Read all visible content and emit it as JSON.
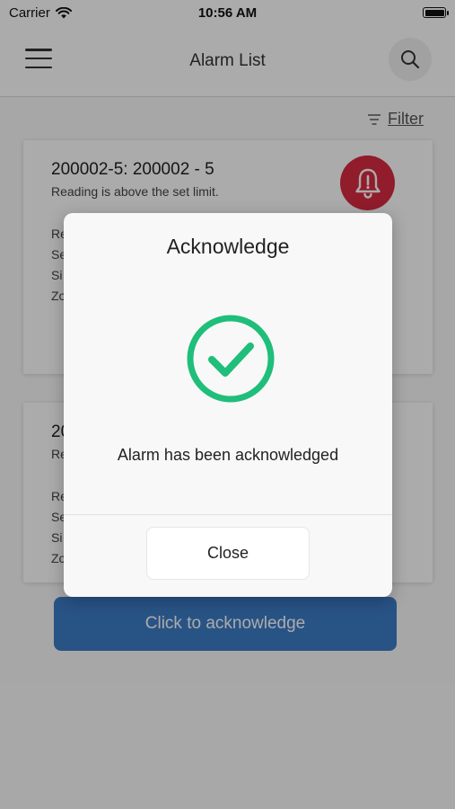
{
  "status_bar": {
    "carrier": "Carrier",
    "time": "10:56 AM"
  },
  "header": {
    "title": "Alarm List",
    "menu_icon": "hamburger-menu-icon",
    "search_icon": "search-icon"
  },
  "filter": {
    "label": "Filter",
    "icon": "filter-lines-icon"
  },
  "cards": [
    {
      "title": "200002-5: 200002 - 5",
      "subtitle": "Reading is above the set limit.",
      "details": [
        "Re",
        "Se",
        "Si",
        "Zo"
      ],
      "icon": "alarm-bell-alert-icon",
      "icon_color": "#d82b40"
    },
    {
      "title": "20",
      "subtitle": "Re",
      "details": [
        "Re",
        "Se",
        "Si",
        "Zo"
      ]
    }
  ],
  "acknowledge_button": {
    "label": "Click to acknowledge",
    "color": "#3d7dc6"
  },
  "dialog": {
    "title": "Acknowledge",
    "message": "Alarm has been acknowledged",
    "close_label": "Close",
    "icon": "check-circle-icon",
    "icon_color": "#1fbe7a"
  }
}
